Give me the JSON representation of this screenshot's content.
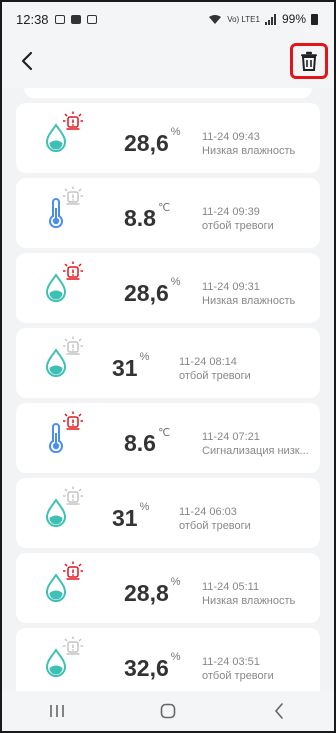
{
  "status_bar": {
    "time": "12:38",
    "network": "Vo) LTE1",
    "battery": "99%"
  },
  "header": {
    "back_icon": "back-arrow-icon",
    "delete_icon": "trash-icon",
    "delete_highlight_color": "#e0161b"
  },
  "colors": {
    "accent_drop": "#3fc0b4",
    "thermo": "#4a8ef0",
    "alarm_active": "#e0161b",
    "alarm_inactive": "#c4c4c4"
  },
  "records": [
    {
      "type": "humidity",
      "value": "28,6",
      "unit": "%",
      "datetime": "11-24 09:43",
      "status": "Низкая влажность",
      "alarm": "active"
    },
    {
      "type": "temperature",
      "value": "8.8",
      "unit": "℃",
      "datetime": "11-24 09:39",
      "status": "отбой тревоги",
      "alarm": "inactive"
    },
    {
      "type": "humidity",
      "value": "28,6",
      "unit": "%",
      "datetime": "11-24 09:31",
      "status": "Низкая влажность",
      "alarm": "active"
    },
    {
      "type": "humidity",
      "value": "31",
      "unit": "%",
      "datetime": "11-24 08:14",
      "status": "отбой тревоги",
      "alarm": "inactive"
    },
    {
      "type": "temperature",
      "value": "8.6",
      "unit": "℃",
      "datetime": "11-24 07:21",
      "status": "Сигнализация низк...",
      "alarm": "active"
    },
    {
      "type": "humidity",
      "value": "31",
      "unit": "%",
      "datetime": "11-24 06:03",
      "status": "отбой тревоги",
      "alarm": "inactive"
    },
    {
      "type": "humidity",
      "value": "28,8",
      "unit": "%",
      "datetime": "11-24 05:11",
      "status": "Низкая влажность",
      "alarm": "active"
    },
    {
      "type": "humidity",
      "value": "32,6",
      "unit": "%",
      "datetime": "11-24 03:51",
      "status": "отбой тревоги",
      "alarm": "inactive"
    }
  ],
  "nav_bar": {
    "recent_icon": "recent-apps-icon",
    "home_icon": "home-icon",
    "back_icon": "system-back-icon"
  }
}
